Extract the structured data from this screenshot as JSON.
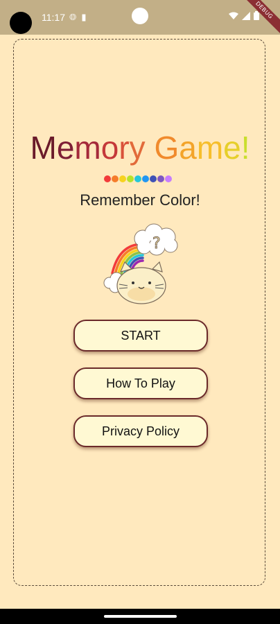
{
  "status_bar": {
    "time": "11:17",
    "icons": [
      "globe-icon",
      "sd-card-icon",
      "wifi-icon",
      "cellular-icon",
      "battery-icon"
    ]
  },
  "debug_banner": "DEBUG",
  "title": {
    "letters": [
      "M",
      "e",
      "m",
      "o",
      "r",
      "y",
      " ",
      "G",
      "a",
      "m",
      "e",
      "!"
    ],
    "colors": [
      "#6A1B2A",
      "#7E1F36",
      "#A42A3A",
      "#C4393A",
      "#D9523A",
      "#E26A3A",
      "#E26A3A",
      "#F08A2C",
      "#F3A42A",
      "#F6BE2B",
      "#E6CF2A",
      "#C9DE2C"
    ]
  },
  "color_dots": [
    "#F23B3B",
    "#F57C2A",
    "#F7D21E",
    "#B8E22A",
    "#26C6DA",
    "#2196F3",
    "#3F51B5",
    "#7E57C2",
    "#C77DFF"
  ],
  "subtitle": "Remember Color!",
  "mascot": {
    "icon": "cat-with-rainbow-and-question-cloud-icon",
    "question_mark": "?"
  },
  "menu": {
    "start": "START",
    "how_to_play": "How To Play",
    "privacy_policy": "Privacy Policy"
  }
}
